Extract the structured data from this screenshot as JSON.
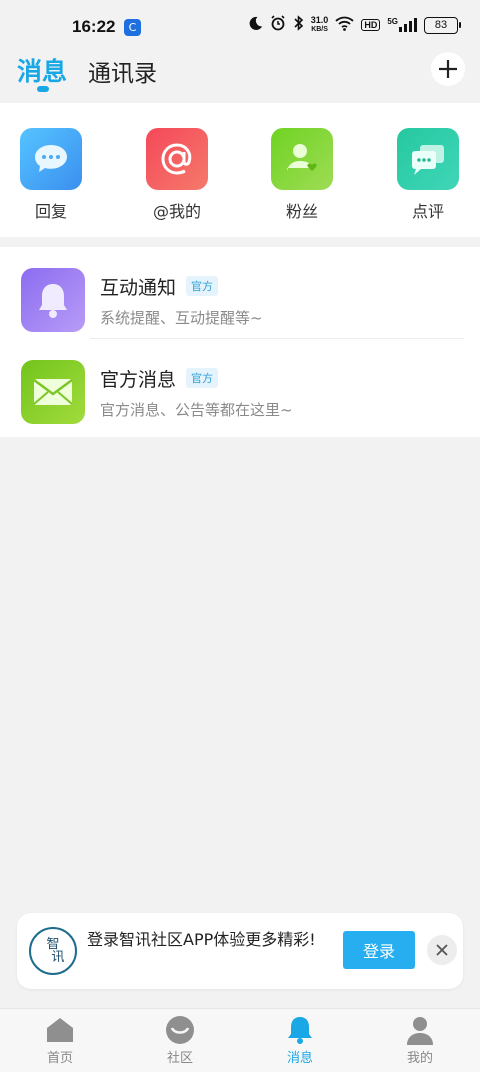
{
  "status_bar": {
    "time": "16:22",
    "app_badge": "C",
    "speed_value": "31.0",
    "speed_unit": "KB/S",
    "hd": "HD",
    "network": "5G",
    "battery": "83"
  },
  "header": {
    "tab_messages": "消息",
    "tab_contacts": "通讯录",
    "accent_color": "#1aa7e6"
  },
  "quick_actions": [
    {
      "label": "回复",
      "icon": "chat-bubble-icon",
      "color": "#4fb4f5"
    },
    {
      "label": "@我的",
      "icon": "at-sign-icon",
      "color": "#f0555e"
    },
    {
      "label": "粉丝",
      "icon": "fans-person-icon",
      "color": "#7ccc3a"
    },
    {
      "label": "点评",
      "icon": "comment-stack-icon",
      "color": "#2fc9a8"
    }
  ],
  "messages": [
    {
      "title": "互动通知",
      "badge": "官方",
      "subtitle": "系统提醒、互动提醒等~",
      "icon": "bell-icon",
      "color": "#9c7ef0"
    },
    {
      "title": "官方消息",
      "badge": "官方",
      "subtitle": "官方消息、公告等都在这里~",
      "icon": "envelope-icon",
      "color": "#86cf2e"
    }
  ],
  "banner": {
    "logo_text_1": "智",
    "logo_text_2": "讯",
    "text": "登录智讯社区APP体验更多精彩!",
    "login_label": "登录"
  },
  "bottom_nav": [
    {
      "label": "首页",
      "icon": "home-icon",
      "active": false
    },
    {
      "label": "社区",
      "icon": "community-icon",
      "active": false
    },
    {
      "label": "消息",
      "icon": "bell-icon",
      "active": true
    },
    {
      "label": "我的",
      "icon": "profile-icon",
      "active": false
    }
  ]
}
